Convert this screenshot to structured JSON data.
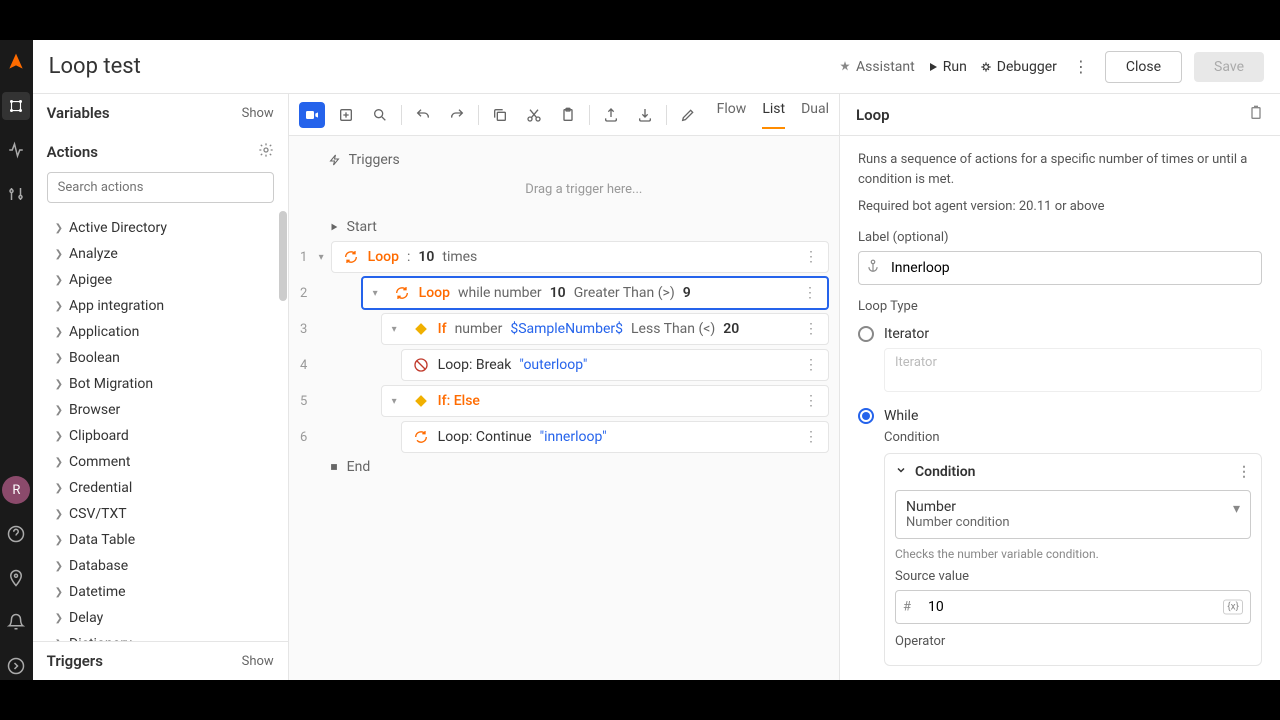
{
  "header": {
    "title": "Loop test",
    "assistant": "Assistant",
    "run": "Run",
    "debugger": "Debugger",
    "close": "Close",
    "save": "Save"
  },
  "leftbar": {
    "avatar": "R"
  },
  "variables": {
    "title": "Variables",
    "show": "Show"
  },
  "actions": {
    "title": "Actions",
    "search_placeholder": "Search actions",
    "items": [
      "Active Directory",
      "Analyze",
      "Apigee",
      "App integration",
      "Application",
      "Boolean",
      "Bot Migration",
      "Browser",
      "Clipboard",
      "Comment",
      "Credential",
      "CSV/TXT",
      "Data Table",
      "Database",
      "Datetime",
      "Delay",
      "Dictionary"
    ]
  },
  "triggers_section": {
    "title": "Triggers",
    "show": "Show"
  },
  "view_tabs": {
    "flow": "Flow",
    "list": "List",
    "dual": "Dual"
  },
  "flow": {
    "triggers_label": "Triggers",
    "trigger_drop": "Drag a trigger here...",
    "start": "Start",
    "end": "End",
    "steps": {
      "s1": {
        "kw": "Loop",
        "sep": ":",
        "num": "10",
        "suffix": "times"
      },
      "s2": {
        "kw": "Loop",
        "t1": "while number",
        "num1": "10",
        "t2": "Greater Than (>)",
        "num2": "9"
      },
      "s3": {
        "kw": "If",
        "t1": "number",
        "var": "$SampleNumber$",
        "t2": "Less Than (<)",
        "num": "20"
      },
      "s4": {
        "t1": "Loop: Break",
        "str": "\"outerloop\""
      },
      "s5": {
        "kw": "If: Else"
      },
      "s6": {
        "t1": "Loop: Continue",
        "str": "\"innerloop\""
      }
    }
  },
  "props": {
    "title": "Loop",
    "desc": "Runs a sequence of actions for a specific number of times or until a condition is met.",
    "req": "Required bot agent version: 20.11 or above",
    "label_lbl": "Label (optional)",
    "label_val": "Innerloop",
    "loop_type": "Loop Type",
    "iterator": "Iterator",
    "iterator_ph": "Iterator",
    "while": "While",
    "condition_lbl": "Condition",
    "condition_hdr": "Condition",
    "select_main": "Number",
    "select_sub": "Number condition",
    "cond_hint": "Checks the number variable condition.",
    "source_lbl": "Source value",
    "source_val": "10",
    "operator_lbl": "Operator"
  }
}
